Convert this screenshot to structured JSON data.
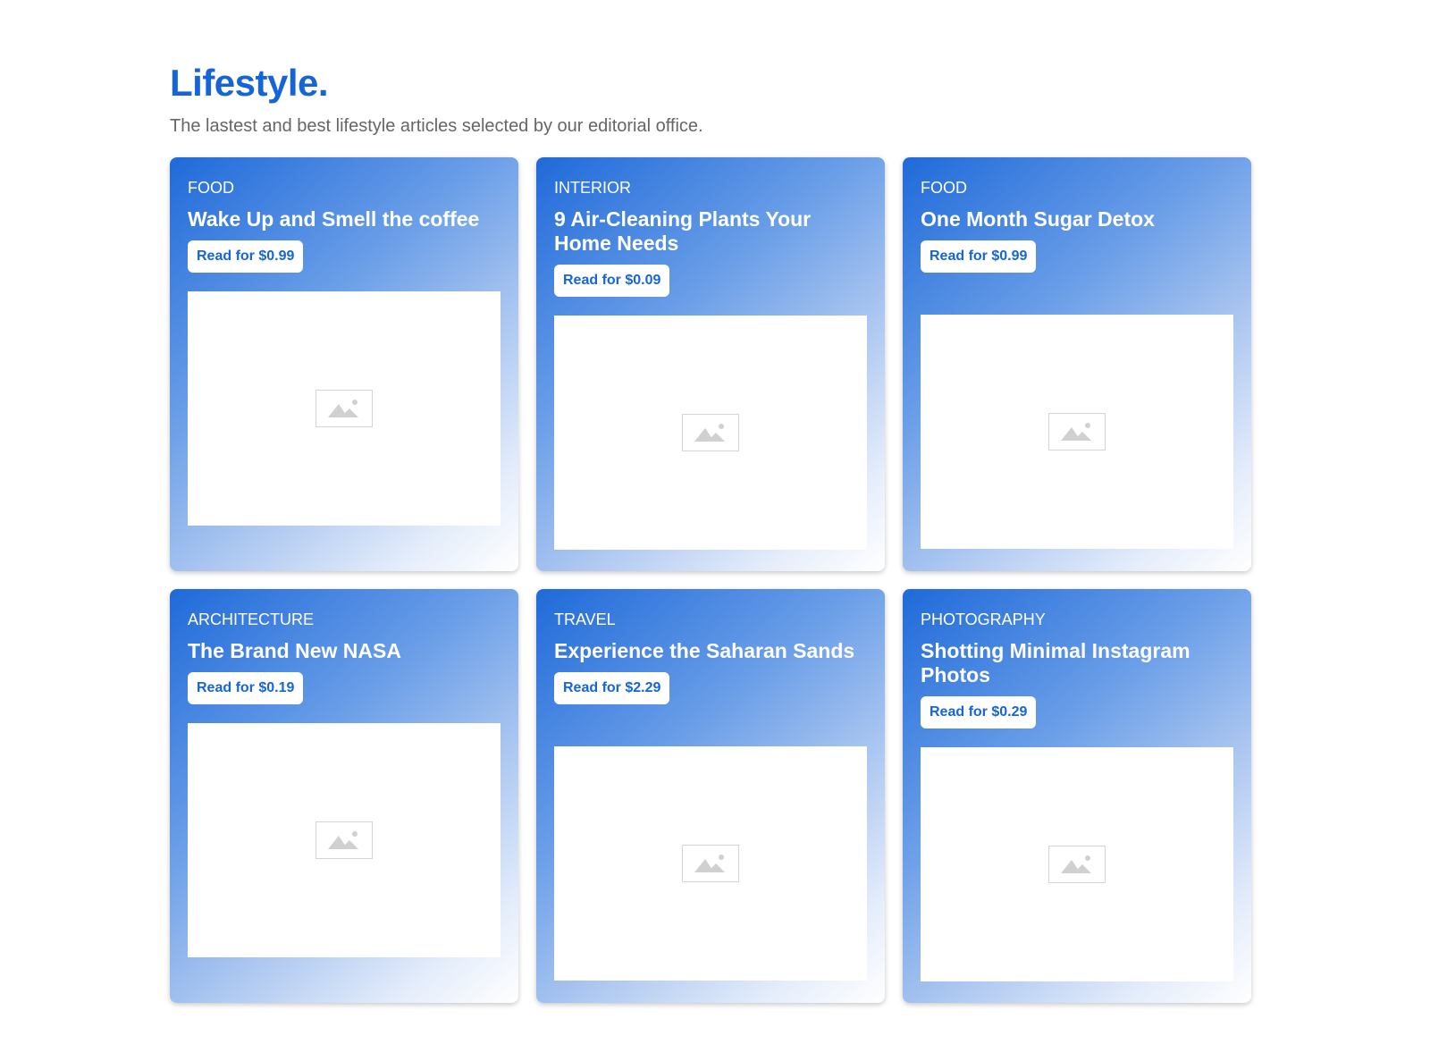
{
  "header": {
    "title": "Lifestyle.",
    "subtitle": "The lastest and best lifestyle articles selected by our editorial office."
  },
  "cards": [
    {
      "category": "FOOD",
      "title": "Wake Up and Smell the coffee",
      "price_label": "Read for $0.99",
      "image_icon": "image-placeholder-icon"
    },
    {
      "category": "INTERIOR",
      "title": "9 Air-Cleaning Plants Your Home Needs",
      "price_label": "Read for $0.09",
      "image_icon": "image-placeholder-icon"
    },
    {
      "category": "FOOD",
      "title": "One Month Sugar Detox",
      "price_label": "Read for $0.99",
      "image_icon": "image-placeholder-icon"
    },
    {
      "category": "ARCHITECTURE",
      "title": "The Brand New NASA",
      "price_label": "Read for $0.19",
      "image_icon": "image-placeholder-icon"
    },
    {
      "category": "TRAVEL",
      "title": "Experience the Saharan Sands",
      "price_label": "Read for $2.29",
      "image_icon": "image-placeholder-icon"
    },
    {
      "category": "PHOTOGRAPHY",
      "title": "Shotting Minimal Instagram Photos",
      "price_label": "Read for $0.29",
      "image_icon": "image-placeholder-icon"
    }
  ],
  "colors": {
    "accent": "#1565d8",
    "gradient_start": "#1f6ad9",
    "gradient_end": "#ffffff",
    "subtitle_text": "#666666"
  }
}
